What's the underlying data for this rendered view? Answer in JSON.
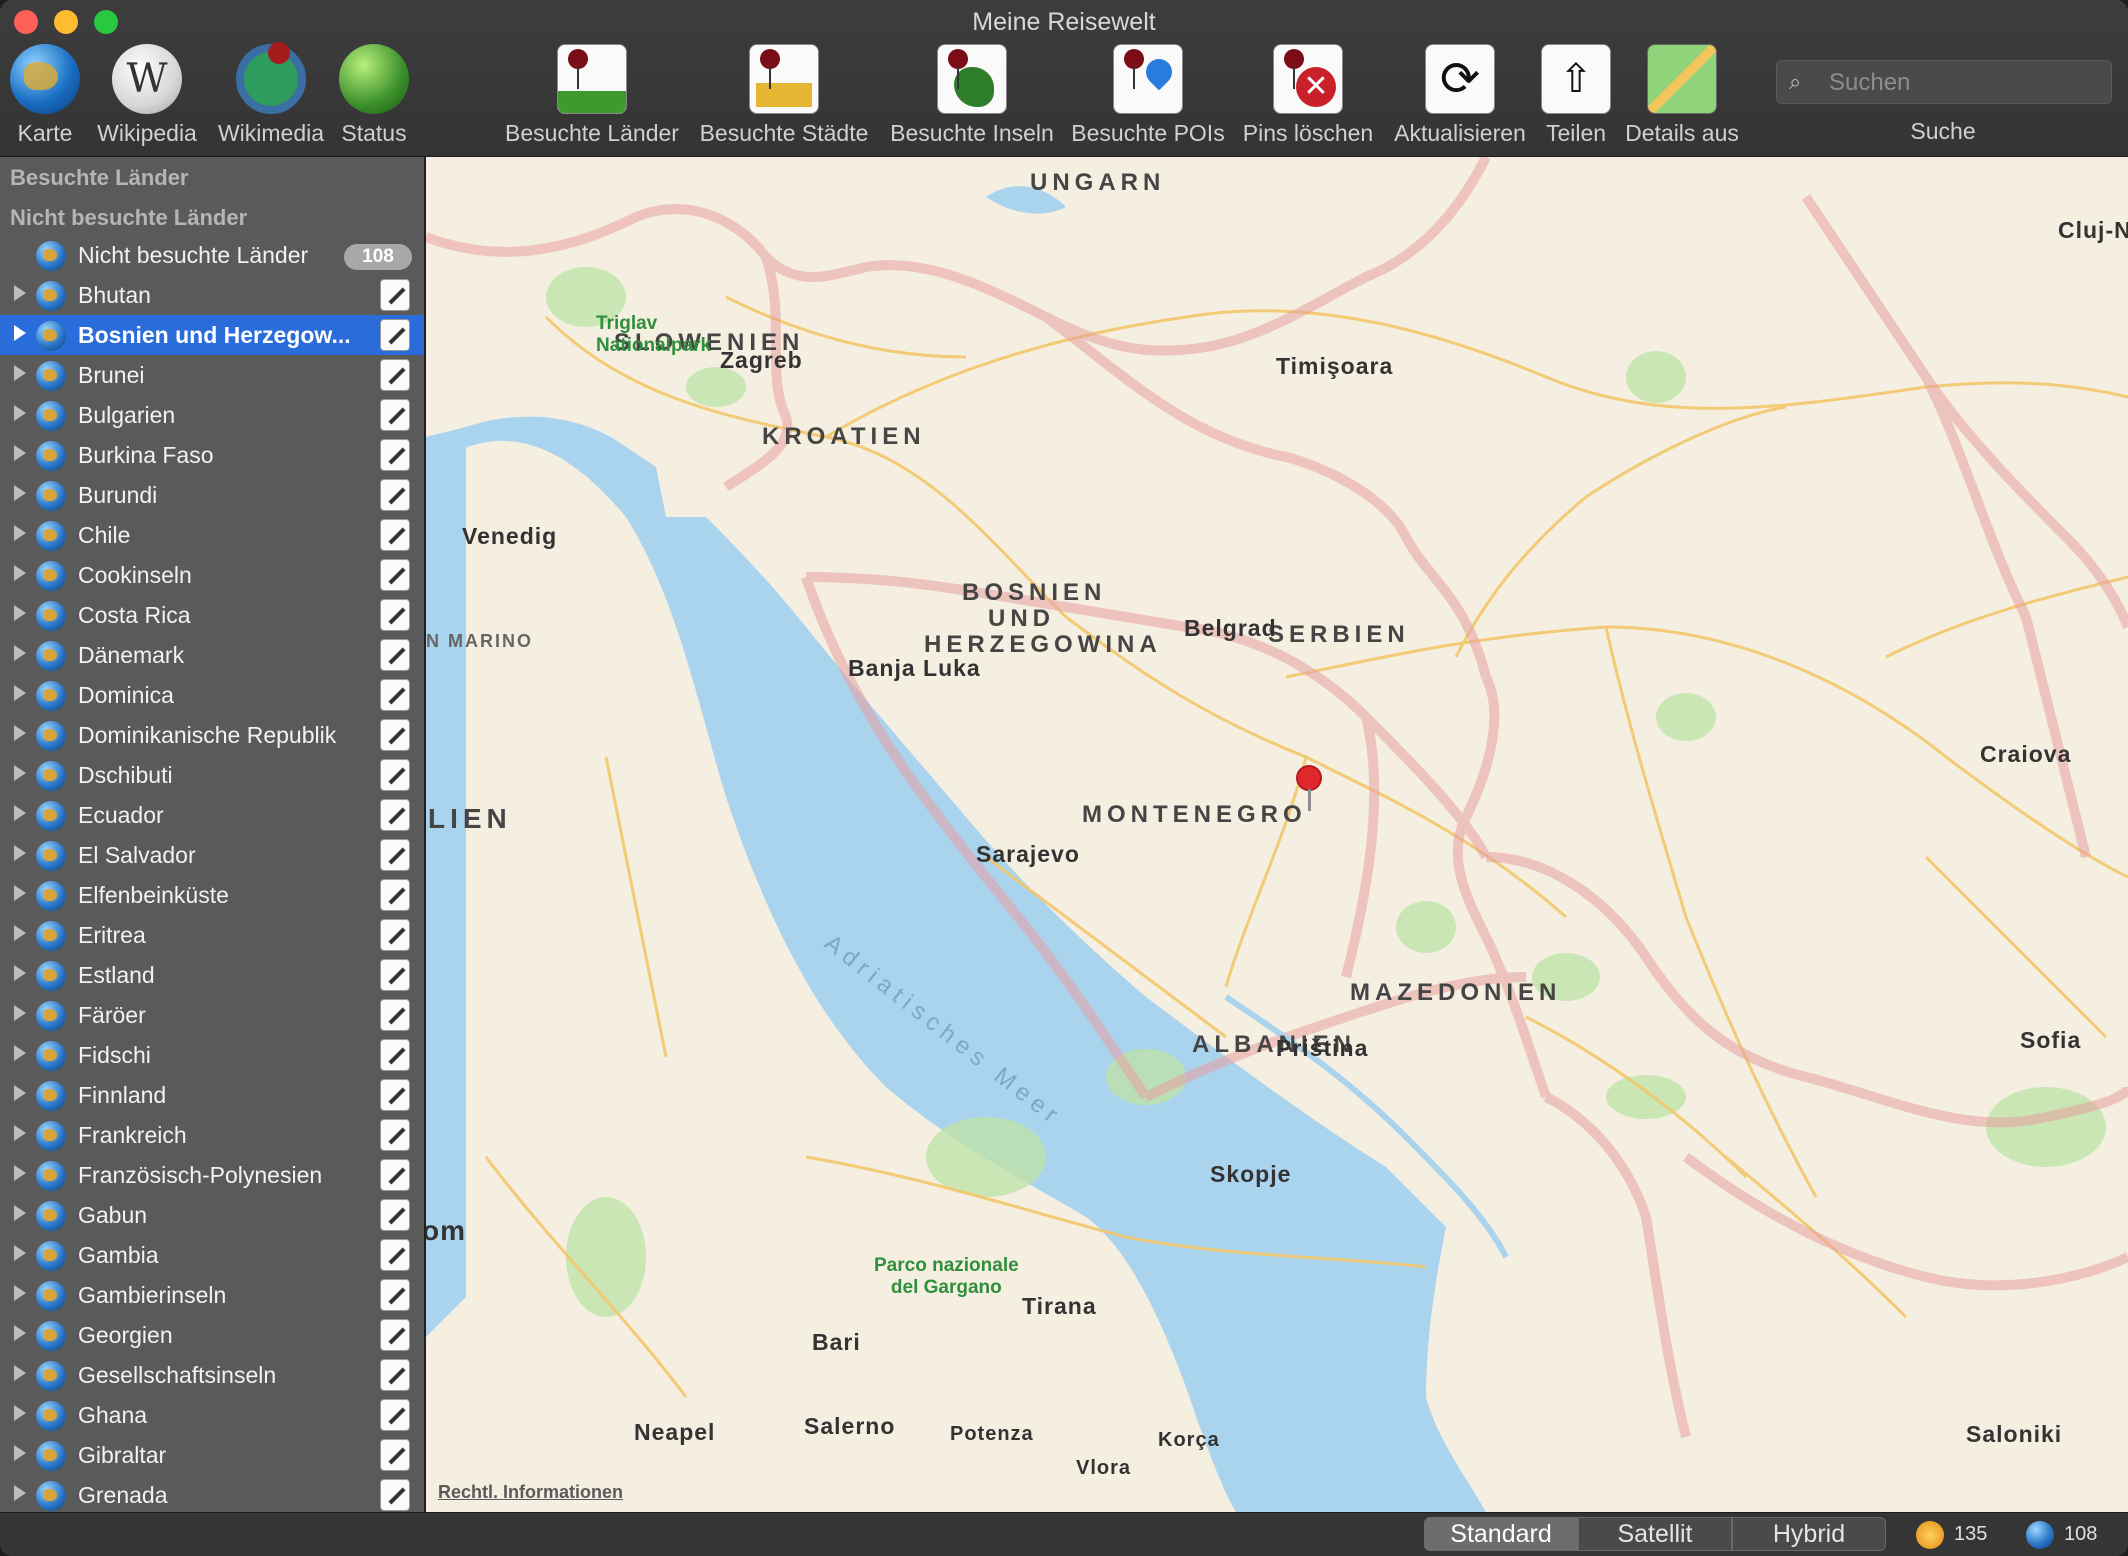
{
  "window": {
    "title": "Meine Reisewelt"
  },
  "toolbar": {
    "left": [
      {
        "label": "Karte",
        "icon": "globe-icon"
      },
      {
        "label": "Wikipedia",
        "icon": "wikipedia-icon"
      },
      {
        "label": "Wikimedia",
        "icon": "wikimedia-icon"
      },
      {
        "label": "Status",
        "icon": "status-icon"
      }
    ],
    "actions": [
      {
        "label": "Besuchte Länder",
        "icon": "visited-countries-icon"
      },
      {
        "label": "Besuchte Städte",
        "icon": "visited-cities-icon"
      },
      {
        "label": "Besuchte Inseln",
        "icon": "visited-islands-icon"
      },
      {
        "label": "Besuchte POIs",
        "icon": "visited-pois-icon"
      },
      {
        "label": "Pins löschen",
        "icon": "delete-pins-icon"
      },
      {
        "label": "Aktualisieren",
        "icon": "refresh-icon"
      },
      {
        "label": "Teilen",
        "icon": "share-icon"
      },
      {
        "label": "Details aus",
        "icon": "details-icon"
      }
    ],
    "search": {
      "placeholder": "Suchen",
      "label": "Suche"
    }
  },
  "sidebar": {
    "section_visited": "Besuchte Länder",
    "section_unvisited": "Nicht besuchte Länder",
    "group": {
      "label": "Nicht besuchte Länder",
      "count": "108"
    },
    "selected_index": 1,
    "items": [
      "Bhutan",
      "Bosnien und Herzegow...",
      "Brunei",
      "Bulgarien",
      "Burkina Faso",
      "Burundi",
      "Chile",
      "Cookinseln",
      "Costa Rica",
      "Dänemark",
      "Dominica",
      "Dominikanische Republik",
      "Dschibuti",
      "Ecuador",
      "El Salvador",
      "Elfenbeinküste",
      "Eritrea",
      "Estland",
      "Färöer",
      "Fidschi",
      "Finnland",
      "Frankreich",
      "Französisch-Polynesien",
      "Gabun",
      "Gambia",
      "Gambierinseln",
      "Georgien",
      "Gesellschaftsinseln",
      "Ghana",
      "Gibraltar",
      "Grenada"
    ]
  },
  "map": {
    "countries": [
      "UNGARN",
      "SLOWENIEN",
      "KROATIEN",
      "BOSNIEN",
      "UND",
      "HERZEGOWINA",
      "SERBIEN",
      "MONTENEGRO",
      "MAZEDONIEN",
      "ALBANIEN",
      "LIEN",
      "N MARINO"
    ],
    "cities": [
      "Cluj-N",
      "Zagreb",
      "Timişoara",
      "Venedig",
      "Banja Luka",
      "Belgrad",
      "Craiova",
      "Sarajevo",
      "Priština",
      "Sofia",
      "Skopje",
      "Tirana",
      "Bari",
      "Neapel",
      "Salerno",
      "Potenza",
      "Korça",
      "Vlora",
      "Saloniki",
      "om"
    ],
    "parks": {
      "triglav": "Triglav\nNationalpark",
      "gargano": "Parco nazionale\ndel Gargano"
    },
    "sea": "Adriatisches Meer",
    "legal": "Rechtl. Informationen",
    "colors": {
      "land": "#f5efe1",
      "water": "#aad3ee",
      "border": "#e8a0a0",
      "road": "#f3c76a",
      "park": "#bfe3a9",
      "pin": "#e0272b"
    }
  },
  "bottombar": {
    "segments": [
      "Standard",
      "Satellit",
      "Hybrid"
    ],
    "active_segment": "Standard",
    "visited_count": "135",
    "unvisited_count": "108"
  }
}
